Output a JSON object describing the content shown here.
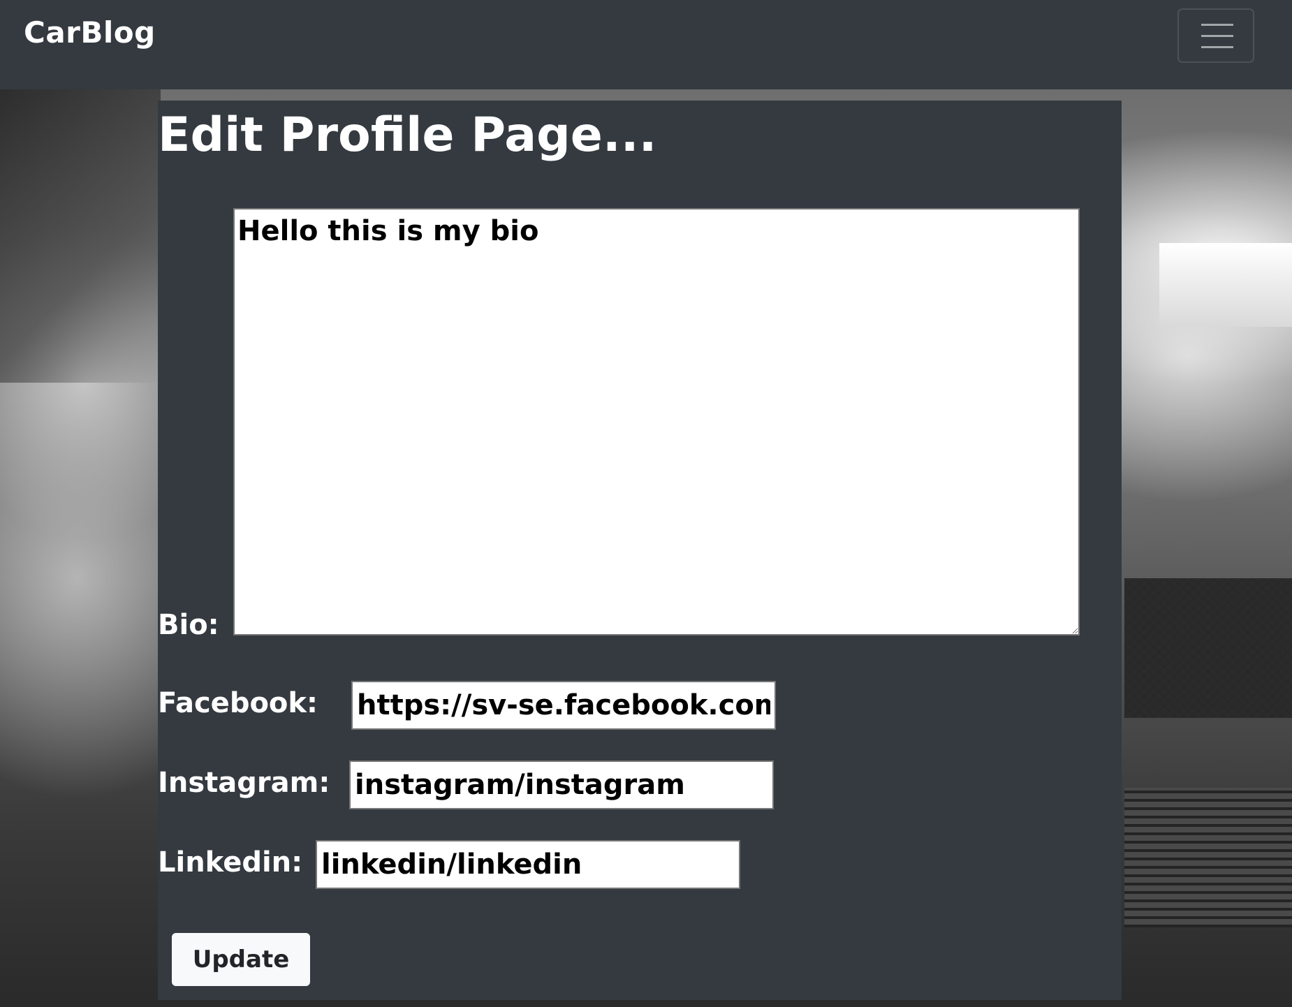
{
  "navbar": {
    "brand": "CarBlog",
    "toggler_icon": "hamburger-menu-icon"
  },
  "page": {
    "title": "Edit Profile Page..."
  },
  "form": {
    "bio": {
      "label": "Bio:",
      "value": "Hello this is my bio"
    },
    "facebook": {
      "label": "Facebook:",
      "value": "https://sv-se.facebook.com"
    },
    "instagram": {
      "label": "Instagram:",
      "value": "instagram/instagram"
    },
    "linkedin": {
      "label": "Linkedin:",
      "value": "linkedin/linkedin"
    },
    "submit_label": "Update"
  },
  "colors": {
    "navbar_bg": "#343a40",
    "panel_bg": "#343a40",
    "text": "#ffffff",
    "button_bg": "#f8f9fa"
  }
}
